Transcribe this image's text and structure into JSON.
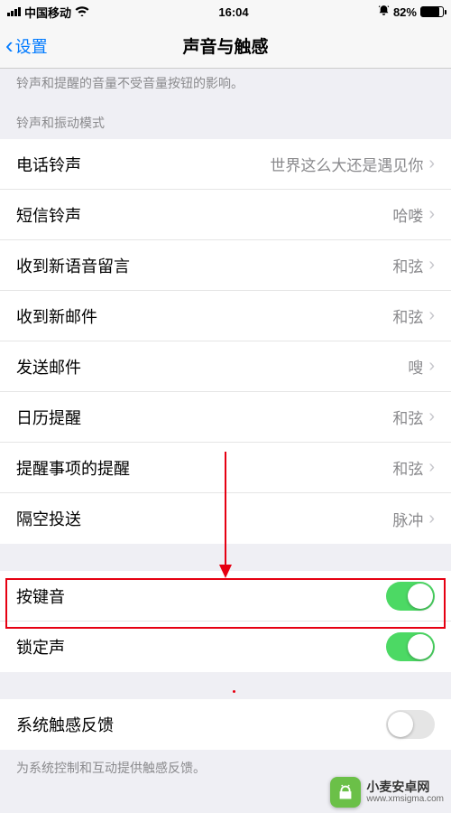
{
  "status": {
    "carrier": "中国移动",
    "time": "16:04",
    "battery_pct": "82%",
    "battery_level": 82
  },
  "nav": {
    "back": "设置",
    "title": "声音与触感"
  },
  "hint_top": "铃声和提醒的音量不受音量按钮的影响。",
  "section_header": "铃声和振动模式",
  "rows": [
    {
      "label": "电话铃声",
      "value": "世界这么大还是遇见你"
    },
    {
      "label": "短信铃声",
      "value": "哈喽"
    },
    {
      "label": "收到新语音留言",
      "value": "和弦"
    },
    {
      "label": "收到新邮件",
      "value": "和弦"
    },
    {
      "label": "发送邮件",
      "value": "嗖"
    },
    {
      "label": "日历提醒",
      "value": "和弦"
    },
    {
      "label": "提醒事项的提醒",
      "value": "和弦"
    },
    {
      "label": "隔空投送",
      "value": "脉冲"
    }
  ],
  "toggles": [
    {
      "label": "按键音",
      "on": true
    },
    {
      "label": "锁定声",
      "on": true
    }
  ],
  "haptic": {
    "label": "系统触感反馈",
    "on": false
  },
  "hint_bottom": "为系统控制和互动提供触感反馈。",
  "watermark": {
    "title": "小麦安卓网",
    "url": "www.xmsigma.com"
  }
}
